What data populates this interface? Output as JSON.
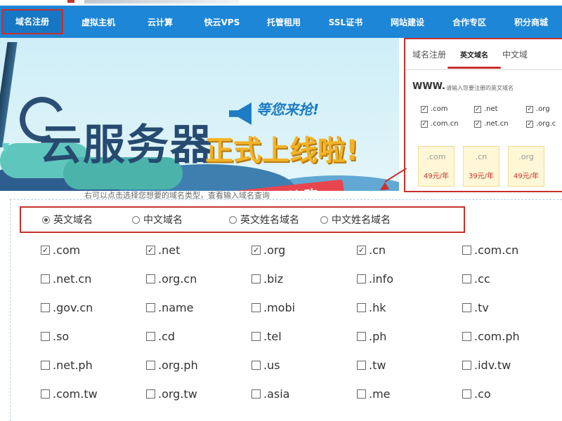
{
  "nav": {
    "items": [
      {
        "label": "域名注册",
        "active": true
      },
      {
        "label": "虚拟主机"
      },
      {
        "label": "云计算"
      },
      {
        "label": "快云VPS"
      },
      {
        "label": "托管租用"
      },
      {
        "label": "SSL证书"
      },
      {
        "label": "网站建设"
      },
      {
        "label": "合作专区"
      },
      {
        "label": "积分商城"
      }
    ]
  },
  "banner": {
    "main": "云服务器",
    "sub": "正式上线啦!",
    "slogan": "等您来抢!",
    "button": "立即抢购"
  },
  "mini": {
    "tabs": [
      "域名注册",
      "英文域名",
      "中文域"
    ],
    "www": "WWW.",
    "hint": "请输入您要注册的英文域名",
    "exts": [
      ".com",
      ".net",
      ".org",
      ".com.cn",
      ".net.cn",
      ".org.c"
    ],
    "prices": [
      {
        "ext": ".com",
        "price": "49元/年"
      },
      {
        "ext": ".cn",
        "price": "39元/年"
      },
      {
        "ext": ".org",
        "price": "49元/年"
      }
    ]
  },
  "caption": "右可以点击选择您想要的域名类型，查看输入域名查询",
  "domain_types": [
    {
      "label": "英文域名",
      "selected": true
    },
    {
      "label": "中文域名",
      "selected": false
    },
    {
      "label": "英文姓名域名",
      "selected": false
    },
    {
      "label": "中文姓名域名",
      "selected": false
    }
  ],
  "extensions": [
    {
      "label": ".com",
      "checked": true
    },
    {
      "label": ".net",
      "checked": true
    },
    {
      "label": ".org",
      "checked": true
    },
    {
      "label": ".cn",
      "checked": true
    },
    {
      "label": ".com.cn",
      "checked": false
    },
    {
      "label": ".net.cn",
      "checked": false
    },
    {
      "label": ".org.cn",
      "checked": false
    },
    {
      "label": ".biz",
      "checked": false
    },
    {
      "label": ".info",
      "checked": false
    },
    {
      "label": ".cc",
      "checked": false
    },
    {
      "label": ".gov.cn",
      "checked": false
    },
    {
      "label": ".name",
      "checked": false
    },
    {
      "label": ".mobi",
      "checked": false
    },
    {
      "label": ".hk",
      "checked": false
    },
    {
      "label": ".tv",
      "checked": false
    },
    {
      "label": ".so",
      "checked": false
    },
    {
      "label": ".cd",
      "checked": false
    },
    {
      "label": ".tel",
      "checked": false
    },
    {
      "label": ".ph",
      "checked": false
    },
    {
      "label": ".com.ph",
      "checked": false
    },
    {
      "label": ".net.ph",
      "checked": false
    },
    {
      "label": ".org.ph",
      "checked": false
    },
    {
      "label": ".us",
      "checked": false
    },
    {
      "label": ".tw",
      "checked": false
    },
    {
      "label": ".idv.tw",
      "checked": false
    },
    {
      "label": ".com.tw",
      "checked": false
    },
    {
      "label": ".org.tw",
      "checked": false
    },
    {
      "label": ".asia",
      "checked": false
    },
    {
      "label": ".me",
      "checked": false
    },
    {
      "label": ".co",
      "checked": false
    }
  ],
  "colors": {
    "nav": "#1e86d6",
    "highlight": "#c9302c",
    "accent": "#f2b326"
  }
}
